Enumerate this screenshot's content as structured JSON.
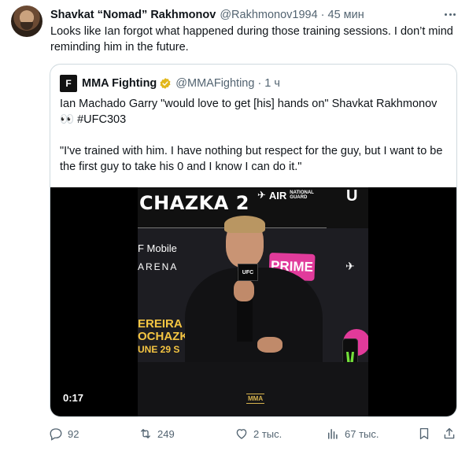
{
  "tweet": {
    "author_name": "Shavkat “Nomad” Rakhmonov",
    "handle": "@Rakhmonov1994",
    "separator": "·",
    "time": "45 мин",
    "text": "Looks like Ian forgot what happened during those training sessions. I don’t mind reminding him in the future."
  },
  "quote": {
    "logo_text": "F",
    "author_name": "MMA Fighting",
    "handle": "@MMAFighting",
    "separator": "·",
    "time": "1 ч",
    "paragraph1": "Ian Machado Garry \"would love to get [his] hands on\" Shavkat Rakhmonov 👀 #UFC303",
    "paragraph2": "\"I've trained with him. I have nothing but respect for the guy, but I want to be the first guy to take his 0 and I know I can do it.\""
  },
  "video": {
    "duration": "0:17",
    "banner_text": "CHAZKA 2",
    "airforce_text": "AIR",
    "airforce_sub1": "NATIONAL",
    "airforce_sub2": "GUARD",
    "tmobile_text": "F Mobile",
    "arena_text": "ARENA",
    "prime_text": "PRIME",
    "event_line1": "EREIRA",
    "event_line2": "OCHAZK",
    "event_line3": "UNE 29 S",
    "mic_text": "UFC",
    "mma_logo": "MMA",
    "corner_mark": "U"
  },
  "actions": {
    "reply_count": "92",
    "retweet_count": "249",
    "like_count": "2 тыс.",
    "views_count": "67 тыс."
  },
  "colors": {
    "text_primary": "#0f1419",
    "text_secondary": "#536471",
    "border": "#cfd9de",
    "verified_gold": "#e2b719"
  },
  "icons": [
    "reply-icon",
    "retweet-icon",
    "like-icon",
    "views-icon",
    "bookmark-icon",
    "share-icon",
    "more-icon",
    "verified-icon"
  ]
}
